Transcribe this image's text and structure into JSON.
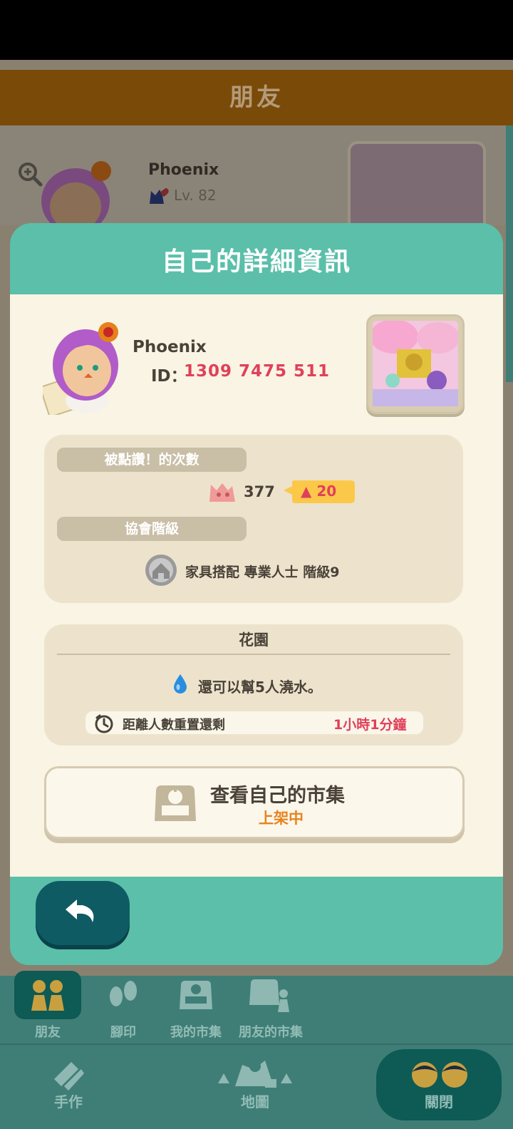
{
  "background": {
    "header_title": "朋友",
    "friend": {
      "name": "Phoenix",
      "level": "Lv. 82"
    }
  },
  "modal": {
    "title": "自己的詳細資訊",
    "profile": {
      "name": "Phoenix",
      "id_label": "ID：",
      "id_value": "1309 7475 511"
    },
    "kudos": {
      "label": "被點讚！的次數",
      "count": "377",
      "delta": "▲ 20"
    },
    "rank": {
      "label": "協會階級",
      "value": "家具搭配 專業人士 階級9"
    },
    "garden": {
      "title": "花園",
      "water_text": "還可以幫5人澆水。",
      "reset_label": "距離人數重置還剩",
      "reset_time": "1小時1分鐘"
    },
    "market_button": {
      "label": "查看自己的市集",
      "status": "上架中"
    }
  },
  "bottom_nav": {
    "row1": [
      {
        "label": "朋友",
        "icon": "friends-icon"
      },
      {
        "label": "腳印",
        "icon": "footprints-icon"
      },
      {
        "label": "我的市集",
        "icon": "my-market-icon"
      },
      {
        "label": "朋友的市集",
        "icon": "friends-market-icon"
      }
    ],
    "row2": [
      {
        "label": "手作",
        "icon": "crafting-icon"
      },
      {
        "label": "地圖",
        "icon": "map-icon"
      },
      {
        "label": "關閉",
        "icon": "close-friends-icon"
      }
    ]
  },
  "colors": {
    "teal": "#5bbfaa",
    "dark_teal": "#0f5b63",
    "accent_pink": "#e0405a",
    "accent_orange": "#e8821e",
    "badge_yellow": "#fbc84a",
    "cream": "#f9f4e3"
  }
}
